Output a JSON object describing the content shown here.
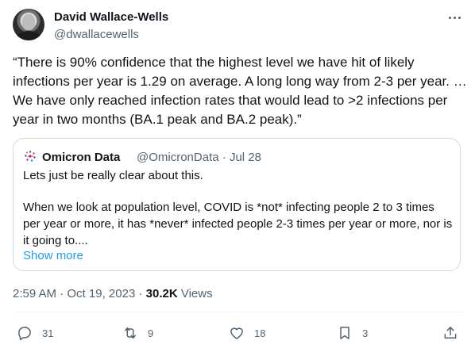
{
  "author": {
    "name": "David Wallace-Wells",
    "handle": "@dwallacewells"
  },
  "tweet": {
    "lines": [
      "“There is 90% confidence that the highest level we have hit of likely",
      "infections per year is 1.29 on average. A long long way from 2-3 per year. …",
      "We have only reached infection rates that would lead to >2 infections per",
      "year in two months (BA.1 peak and BA.2 peak).”"
    ]
  },
  "quoted": {
    "name": "Omicron Data",
    "handle": "@OmicronData",
    "separator": "·",
    "date": "Jul 28",
    "lines": [
      "Lets just be really clear about this.",
      "",
      "When we look at population level, COVID is *not* infecting people 2 to 3 times",
      "per year or more, it has *never* infected people 2-3 times per year or more, nor is",
      "it going to...."
    ],
    "show_more": "Show more"
  },
  "meta": {
    "time": "2:59 AM",
    "separator": "·",
    "date": "Oct 19, 2023",
    "separator2": "·",
    "views": "30.2K",
    "views_label": "Views"
  },
  "actions": {
    "replies": "31",
    "reposts": "9",
    "likes": "18",
    "bookmarks": "3"
  },
  "colors": {
    "text": "#0f1419",
    "secondary": "#536471",
    "link": "#1d9bf0",
    "border": "#cfd9de"
  },
  "icons": [
    "more-icon",
    "omicron-logo-icon",
    "reply-icon",
    "repost-icon",
    "like-icon",
    "bookmark-icon",
    "share-icon"
  ]
}
